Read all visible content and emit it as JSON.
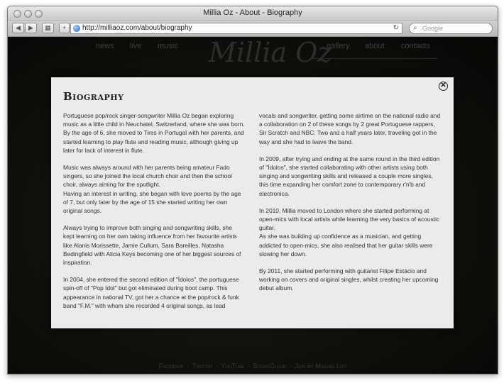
{
  "window": {
    "title": "Millia Oz - About - Biography"
  },
  "toolbar": {
    "back_label": "◀",
    "forward_label": "▶",
    "bookmarks_label": "▦",
    "add_label": "+",
    "url": "http://milliaoz.com/about/biography",
    "reload_label": "↻",
    "search_placeholder": "Google"
  },
  "site": {
    "logo": "Millia Oz",
    "nav_left": [
      "news",
      "live",
      "music"
    ],
    "nav_right": [
      "gallery",
      "about",
      "contacts"
    ],
    "footer": {
      "links": [
        "Facebook",
        "Twitter",
        "YouTube",
        "SoundCloud",
        "Join my Mailing List"
      ],
      "separator": "·"
    }
  },
  "modal": {
    "title": "Biography",
    "close_label": "✕",
    "col1": [
      "Portuguese pop/rock singer-songwriter Millia Oz began exploring music as a little child in Neuchatel, Switzerland, where she was born. By the age of 6, she moved to Tires in Portugal with her parents, and started learning to play flute and reading music, although giving up later for lack of interest in flute.",
      "Music was always around with her parents being amateur Fado singers, so she joined the local church choir and then the school choir, always aiming for the spotlight.\nHaving an interest in writing, she began with love poems by the age of 7, but only later by the age of 15 she started writing her own original songs.",
      "Always trying to improve both singing and songwriting skills, she kept learning on her own taking influence from her favourite artists like Alanis Morissette, Jamie Cullum, Sara Bareilles, Natasha Bedingfield with Alicia Keys becoming one of her biggest sources of inspiration.",
      "In 2004, she entered the second edition of \"Ídolos\", the portuguese spin-off of \"Pop Idol\" but got eliminated during boot camp. This appearance in national TV, got her a chance at the pop/rock & funk band \"F.M.\" with whom she recorded 4 original songs, as lead"
    ],
    "col2": [
      "vocals and songwriter, getting some airtime on the national radio and a collaboration on 2 of these songs by 2 great Portuguese rappers, Sir Scratch and NBC. Two and a half years later, traveling got in the way and she had to leave the band.",
      "In 2009, after trying and ending at the same round in the third edition of \"Ídolos\", she started collaborating with other artists using both singing and songwriting skills and released a couple more singles, this time expanding her comfort zone to contemporary r'n'b and electronica.",
      "In 2010, Millia moved to London where she started performing at open-mics with local artists while learning the very basics of acoustic guitar.\nAs she was building up confidence as a musician, and getting addicted to open-mics, she also realised that her guitar skills were slowing her down.",
      "By 2011, she started performing with guitarist Filipe Estácio and working on covers and original singles, whilst creating her upcoming debut album."
    ]
  }
}
